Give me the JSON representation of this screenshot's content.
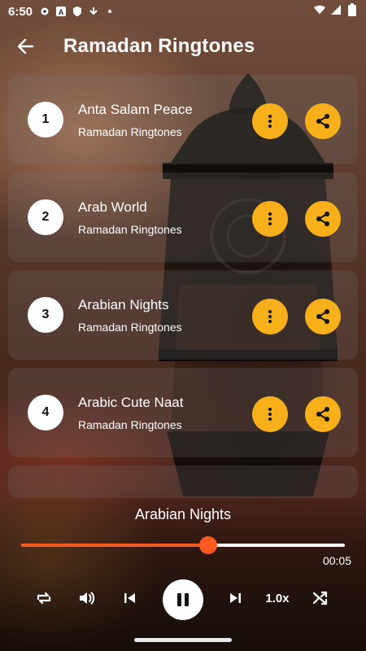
{
  "status_bar": {
    "time": "6:50",
    "left_icons": [
      "gear-icon",
      "a-badge-icon",
      "shield-icon",
      "download-icon",
      "dot-icon"
    ],
    "right_icons": [
      "wifi-icon",
      "signal-icon",
      "battery-icon"
    ]
  },
  "app_bar": {
    "title": "Ramadan Ringtones",
    "back_icon": "arrow-left-icon"
  },
  "ringtones": [
    {
      "number": "1",
      "title": "Anta Salam Peace",
      "subtitle": "Ramadan Ringtones"
    },
    {
      "number": "2",
      "title": "Arab World",
      "subtitle": "Ramadan Ringtones"
    },
    {
      "number": "3",
      "title": "Arabian Nights",
      "subtitle": "Ramadan Ringtones"
    },
    {
      "number": "4",
      "title": "Arabic Cute Naat",
      "subtitle": "Ramadan Ringtones"
    }
  ],
  "colors": {
    "accent": "#f7b01a",
    "progress": "#ff5a1f",
    "track": "#ffffff"
  },
  "player": {
    "now_playing": "Arabian Nights",
    "elapsed": "00:05",
    "progress_fraction": 0.577,
    "speed_label": "1.0x",
    "buttons": [
      "repeat-icon",
      "volume-icon",
      "previous-icon",
      "pause-icon",
      "next-icon",
      "speed",
      "shuffle-icon"
    ]
  }
}
